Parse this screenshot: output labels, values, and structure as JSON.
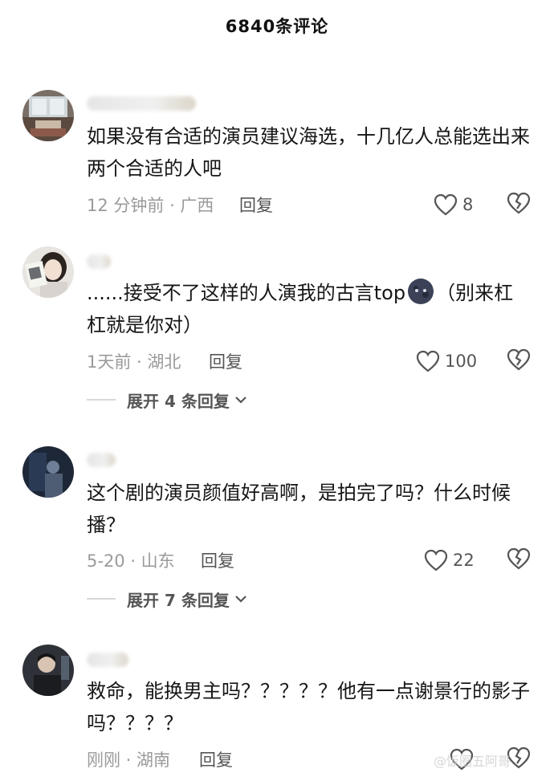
{
  "header": {
    "title": "6840条评论"
  },
  "comments": [
    {
      "content": "如果没有合适的演员建议海选，十几亿人总能选出来两个合适的人吧",
      "time_location": "12 分钟前 · 广西",
      "reply_label": "回复",
      "likes": "8"
    },
    {
      "content_before_emoji": "......接受不了这样的人演我的古言top",
      "emoji": "smiling-moon-emoji",
      "content_after_emoji": "（别来杠 杠就是你对）",
      "time_location": "1天前 · 湖北",
      "reply_label": "回复",
      "likes": "100",
      "expand_label": "展开 4 条回复"
    },
    {
      "content": "这个剧的演员颜值好高啊，是拍完了吗？什么时候播？",
      "time_location": "5-20 · 山东",
      "reply_label": "回复",
      "likes": "22",
      "expand_label": "展开 7 条回复"
    },
    {
      "content": "救命，能换男主吗？？？？？他有一点谢景行的影子吗？？？？",
      "time_location": "刚刚 · 湖南",
      "reply_label": "回复",
      "likes": ""
    }
  ],
  "watermark": "@饭圈五阿哥",
  "icons": {
    "like": "heart-outline-icon",
    "dislike": "broken-heart-icon",
    "expand": "chevron-down-icon"
  },
  "colors": {
    "meta": "#9a9a9a",
    "text": "#161616",
    "action": "#555555"
  }
}
